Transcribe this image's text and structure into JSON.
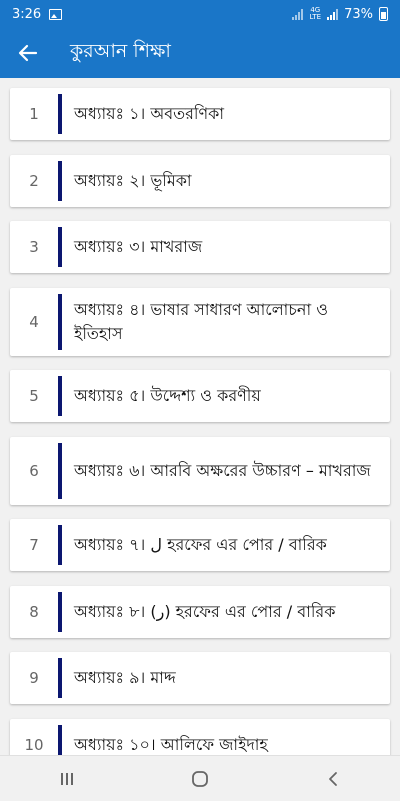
{
  "status_bar": {
    "time": "3:26",
    "network_label_top": "4G",
    "network_label_bottom": "LTE",
    "battery": "73%"
  },
  "app_bar": {
    "title": "কুরআন শিক্ষা",
    "back_icon": "arrow-back-icon"
  },
  "chapters": [
    {
      "number": "1",
      "title": "অধ্যায়ঃ ১। অবতরণিকা"
    },
    {
      "number": "2",
      "title": "অধ্যায়ঃ ২। ভূমিকা"
    },
    {
      "number": "3",
      "title": "অধ্যায়ঃ ৩। মাখরাজ"
    },
    {
      "number": "4",
      "title": "অধ্যায়ঃ ৪। ভাষার সাধারণ আলোচনা ও ইতিহাস"
    },
    {
      "number": "5",
      "title": "অধ্যায়ঃ ৫। উদ্দেশ্য ও করণীয়"
    },
    {
      "number": "6",
      "title": "অধ্যায়ঃ ৬। আরবি অক্ষরের উচ্চারণ – মাখরাজ"
    },
    {
      "number": "7",
      "title": "অধ্যায়ঃ ৭। ل হরফের এর পোর / বারিক"
    },
    {
      "number": "8",
      "title": "অধ্যায়ঃ ৮। (ر) হরফের এর পোর / বারিক"
    },
    {
      "number": "9",
      "title": "অধ্যায়ঃ ৯। মাদ্দ"
    },
    {
      "number": "10",
      "title": "অধ্যায়ঃ ১০। আলিফে জাইদাহ"
    }
  ],
  "colors": {
    "primary": "#1a76c8",
    "accent_bar": "#0c1770",
    "background": "#f1f1f1"
  },
  "nav_bar": {
    "icons": [
      "recent-apps-icon",
      "home-icon",
      "back-icon"
    ]
  }
}
